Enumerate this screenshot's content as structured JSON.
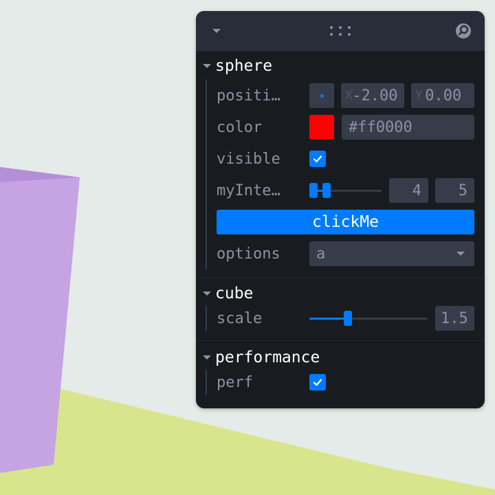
{
  "colors": {
    "background": "#e4ebe8",
    "purple_box": "#c6a3e3",
    "ground": "#d7e68c",
    "panel_bg": "#181c20",
    "accent": "#007bff",
    "field_bg": "#373c4b"
  },
  "titlebar": {
    "collapse_icon": "chevron-down-icon",
    "drag_icon": "drag-handle-icon",
    "search_icon": "search-icon"
  },
  "sphere": {
    "title": "sphere",
    "position": {
      "label": "positi…",
      "x_prefix": "X",
      "x_value": "-2.00",
      "y_prefix": "Y",
      "y_value": "0.00"
    },
    "color": {
      "label": "color",
      "swatch": "#ff0000",
      "value": "#ff0000"
    },
    "visible": {
      "label": "visible",
      "checked": true
    },
    "myInterval": {
      "label": "myInte…",
      "min": "4",
      "max": "5"
    },
    "button": {
      "label": "clickMe"
    },
    "options": {
      "label": "options",
      "selected": "a"
    }
  },
  "cube": {
    "title": "cube",
    "scale": {
      "label": "scale",
      "value": "1.5",
      "fraction": 0.31
    }
  },
  "performance": {
    "title": "performance",
    "perf": {
      "label": "perf",
      "checked": true
    }
  }
}
